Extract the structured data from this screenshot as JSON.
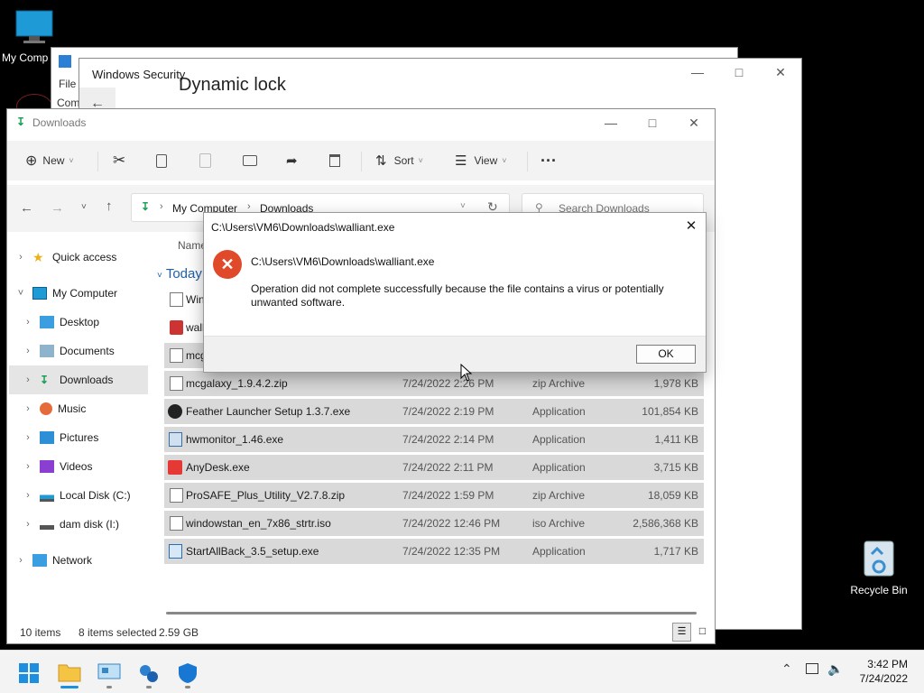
{
  "desktop": {
    "icons": [
      {
        "label": "My Comp"
      },
      {
        "label": "Recycle Bin"
      }
    ]
  },
  "bg_window": {
    "menu_file": "File",
    "menu_com": "Com"
  },
  "security_window": {
    "title": "Windows Security",
    "heading": "Dynamic lock"
  },
  "explorer": {
    "title": "Downloads",
    "toolbar": {
      "new_label": "New",
      "sort_label": "Sort",
      "view_label": "View",
      "more_label": "···"
    },
    "breadcrumb": {
      "root": "My Computer",
      "current": "Downloads"
    },
    "search_placeholder": "Search Downloads",
    "column_name": "Name",
    "group_today": "Today",
    "nav": [
      {
        "label": "Quick access"
      },
      {
        "label": "My Computer"
      },
      {
        "label": "Desktop"
      },
      {
        "label": "Documents"
      },
      {
        "label": "Downloads"
      },
      {
        "label": "Music"
      },
      {
        "label": "Pictures"
      },
      {
        "label": "Videos"
      },
      {
        "label": "Local Disk (C:)"
      },
      {
        "label": "dam disk (I:)"
      },
      {
        "label": "Network"
      }
    ],
    "files": [
      {
        "name": "Win",
        "date": "",
        "type": "",
        "size": ""
      },
      {
        "name": "wall",
        "date": "",
        "type": "",
        "size": ""
      },
      {
        "name": "mcg",
        "date": "",
        "type": "",
        "size": ""
      },
      {
        "name": "mcgalaxy_1.9.4.2.zip",
        "date": "7/24/2022 2:26 PM",
        "type": "zip Archive",
        "size": "1,978 KB"
      },
      {
        "name": "Feather Launcher Setup 1.3.7.exe",
        "date": "7/24/2022 2:19 PM",
        "type": "Application",
        "size": "101,854 KB"
      },
      {
        "name": "hwmonitor_1.46.exe",
        "date": "7/24/2022 2:14 PM",
        "type": "Application",
        "size": "1,411 KB"
      },
      {
        "name": "AnyDesk.exe",
        "date": "7/24/2022 2:11 PM",
        "type": "Application",
        "size": "3,715 KB"
      },
      {
        "name": "ProSAFE_Plus_Utility_V2.7.8.zip",
        "date": "7/24/2022 1:59 PM",
        "type": "zip Archive",
        "size": "18,059 KB"
      },
      {
        "name": "windowstan_en_7x86_strtr.iso",
        "date": "7/24/2022 12:46 PM",
        "type": "iso Archive",
        "size": "2,586,368 KB"
      },
      {
        "name": "StartAllBack_3.5_setup.exe",
        "date": "7/24/2022 12:35 PM",
        "type": "Application",
        "size": "1,717 KB"
      }
    ],
    "status": {
      "items": "10 items",
      "selected": "8 items selected",
      "size": "2.59 GB"
    }
  },
  "dialog": {
    "title": "C:\\Users\\VM6\\Downloads\\walliant.exe",
    "path": "C:\\Users\\VM6\\Downloads\\walliant.exe",
    "message": "Operation did not complete successfully because the file contains a virus or potentially unwanted software.",
    "ok_label": "OK"
  },
  "taskbar": {
    "time": "3:42 PM",
    "date": "7/24/2022"
  }
}
